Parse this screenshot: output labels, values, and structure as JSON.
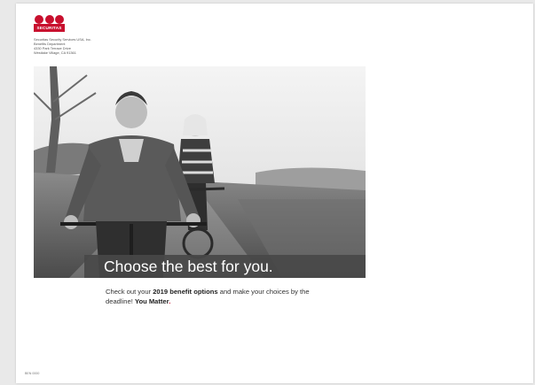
{
  "brand": {
    "logo_text": "SECURITAS",
    "accent_color": "#c8102e"
  },
  "address": {
    "line1": "Securitas Security Services USA, Inc.",
    "line2": "Benefits Department",
    "line3": "4330 Park Terrace Drive",
    "line4": "Westlake Village, CA 91361"
  },
  "hero": {
    "image": "black-and-white-photo-couple-riding-bicycles",
    "banner_text": "Choose the best for you."
  },
  "cta": {
    "text_before": "Check out your ",
    "bold_1": "2019 benefit options",
    "text_middle": " and make your choices by the deadline! ",
    "bold_2": "You Matter",
    "accent_mark": "."
  },
  "footer": {
    "code": "BEN 0000"
  }
}
